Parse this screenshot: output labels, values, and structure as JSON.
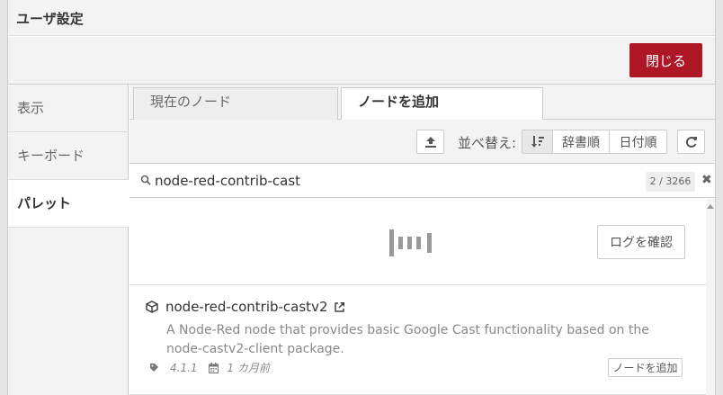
{
  "dialog": {
    "title": "ユーザ設定",
    "close_label": "閉じる"
  },
  "sidebar": {
    "items": [
      {
        "label": "表示"
      },
      {
        "label": "キーボード"
      },
      {
        "label": "パレット"
      }
    ]
  },
  "tabs": [
    {
      "label": "現在のノード"
    },
    {
      "label": "ノードを追加"
    }
  ],
  "toolbar": {
    "sort_label": "並べ替え:",
    "sort_options": [
      "辞書順",
      "日付順"
    ]
  },
  "search": {
    "value": "node-red-contrib-cast",
    "count": "2 / 3266"
  },
  "log_button": "ログを確認",
  "results": [
    {
      "name": "node-red-contrib-castv2",
      "description": "A Node-Red node that provides basic Google Cast functionality based on the node-castv2-client package.",
      "version": "4.1.1",
      "updated": "1 カ月前",
      "install_label": "ノードを追加"
    }
  ],
  "colors": {
    "accent": "#ad1625"
  }
}
